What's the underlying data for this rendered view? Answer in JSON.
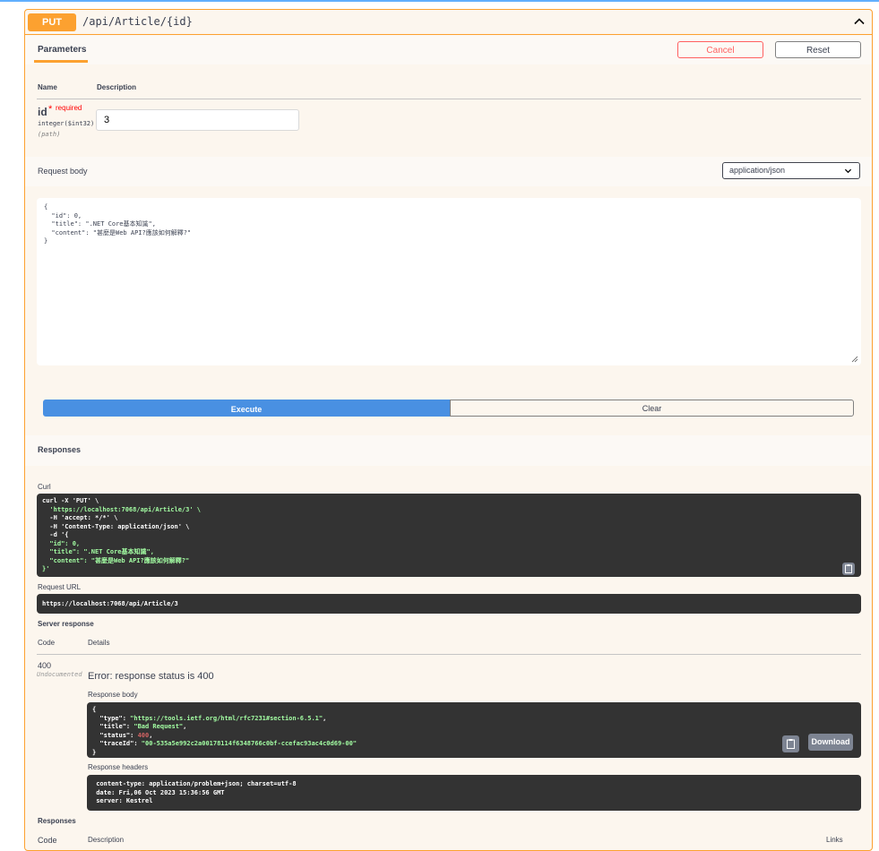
{
  "operation": {
    "method": "PUT",
    "path": "/api/Article/{id}"
  },
  "parameters": {
    "tab_label": "Parameters",
    "cancel_label": "Cancel",
    "reset_label": "Reset",
    "col_name": "Name",
    "col_description": "Description",
    "param": {
      "name": "id",
      "required_star": "*",
      "required_label": "required",
      "type": "integer($int32)",
      "location": "(path)",
      "value": "3"
    }
  },
  "request_body": {
    "label": "Request body",
    "content_type": "application/json",
    "lines": [
      "{",
      "  \"id\": 0,",
      "  \"title\": \".NET Core基本知識\",",
      "  \"content\": \"甚麼是Web API?應該如何解釋?\"",
      "}"
    ]
  },
  "actions": {
    "execute_label": "Execute",
    "clear_label": "Clear"
  },
  "responses_section": {
    "title": "Responses",
    "curl_label": "Curl",
    "curl_lines": [
      "curl -X 'PUT' \\",
      "  'https://localhost:7068/api/Article/3' \\",
      "  -H 'accept: */*' \\",
      "  -H 'Content-Type: application/json' \\",
      "  -d '{",
      "  \"id\": 0,",
      "  \"title\": \".NET Core基本知識\",",
      "  \"content\": \"甚麼是Web API?應該如何解釋?\"",
      "}'"
    ],
    "request_url_label": "Request URL",
    "request_url": "https://localhost:7068/api/Article/3",
    "server_response_label": "Server response",
    "col_code": "Code",
    "col_details": "Details",
    "status_code": "400",
    "undocumented": "Undocumented",
    "error_text": "Error: response status is 400",
    "response_body_label": "Response body",
    "response_body": {
      "type": "https://tools.ietf.org/html/rfc7231#section-6.5.1",
      "title": "Bad Request",
      "status": "400",
      "traceId": "00-535a5e992c2a00178114f6348766c0bf-ccefac93ac4c0d69-00"
    },
    "download_label": "Download",
    "response_headers_label": "Response headers",
    "response_headers": [
      " content-type: application/problem+json; charset=utf-8",
      " date: Fri,06 Oct 2023 15:36:56 GMT",
      " server: Kestrel"
    ]
  },
  "responses_table": {
    "title": "Responses",
    "col_code": "Code",
    "col_description": "Description",
    "col_links": "Links"
  },
  "colors": {
    "put_accent": "#fca130",
    "execute_blue": "#4990e2",
    "cancel_red": "#ff6060",
    "code_bg": "#333333",
    "string_green": "#a2fca2"
  }
}
